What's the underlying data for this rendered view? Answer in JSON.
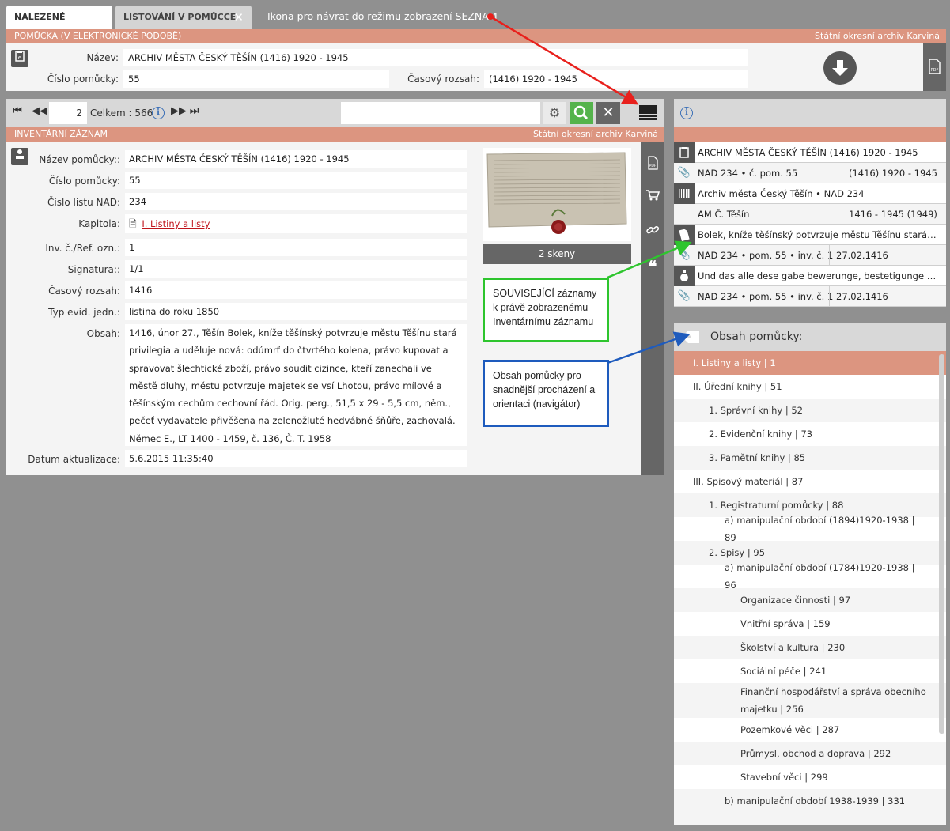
{
  "tabs": [
    {
      "label": "NALEZENÉ ZÁZNAMY"
    },
    {
      "label": "LISTOVÁNÍ V POMŮCCE"
    }
  ],
  "annotation_top": "Ikona pro návrat do režimu zobrazení SEZNAM",
  "helper": {
    "bar_title": "POMŮCKA (V ELEKTRONICKÉ PODOBĚ)",
    "bar_right": "Státní okresní archiv Karviná",
    "name_label": "Název:",
    "name_value": "ARCHIV MĚSTA ČESKÝ TĚŠÍN (1416) 1920 - 1945",
    "number_label": "Číslo pomůcky:",
    "number_value": "55",
    "range_label": "Časový rozsah:",
    "range_value": "(1416) 1920 - 1945"
  },
  "toolbar": {
    "page": "2",
    "total": "Celkem : 566",
    "info_glyph": "i"
  },
  "record": {
    "bar_title": "INVENTÁRNÍ ZÁZNAM",
    "bar_right": "Státní okresní archiv Karviná",
    "fields": {
      "nazev_label": "Název pomůcky::",
      "nazev_value": "ARCHIV MĚSTA ČESKÝ TĚŠÍN (1416) 1920 - 1945",
      "cislo_label": "Číslo pomůcky:",
      "cislo_value": "55",
      "nad_label": "Číslo listu NAD:",
      "nad_value": "234",
      "kapitola_label": "Kapitola:",
      "kapitola_value": "I. Listiny a listy",
      "inv_label": "Inv. č./Ref. ozn.:",
      "inv_value": "1",
      "signatura_label": "Signatura::",
      "signatura_value": "1/1",
      "rozsah_label": "Časový rozsah:",
      "rozsah_value": "1416",
      "typ_label": "Typ evid. jedn.:",
      "typ_value": "listina do roku 1850",
      "obsah_label": "Obsah:",
      "obsah_value": "1416, únor 27., Těšín Bolek, kníže těšínský potvrzuje městu Těšínu stará privilegia a uděluje nová: odúmrť do čtvrtého kolena, právo kupovat a spravovat šlechtické zboží, právo soudit cizince, kteří zanechali ve městě dluhy, městu potvrzuje majetek se vsí Lhotou, právo mílové a těšínským cechům cechovní řád. Orig. perg., 51,5 x 29 - 5,5 cm, něm., pečeť vydavatele přivěšena na zelenožluté hedvábné šňůře, zachovalá. Němec E., LT 1400 - 1459, č. 136, Č. T. 1958",
      "datum_label": "Datum aktualizace:",
      "datum_value": "5.6.2015 11:35:40"
    },
    "scan_label": "2 skeny"
  },
  "callouts": {
    "green": "SOUVISEJÍCÍ záznamy k právě zobrazenému Inventárnímu záznamu",
    "blue": "Obsah pomůcky pro snadnější procházení a orientaci (navigátor)"
  },
  "related": [
    {
      "icon": "book-icon",
      "text": "ARCHIV MĚSTA ČESKÝ TĚŠÍN (1416) 1920 - 1945",
      "text2": ""
    },
    {
      "icon": "paperclip-icon",
      "text": "NAD 234 • č. pom. 55",
      "text2": "(1416) 1920 - 1945"
    },
    {
      "icon": "barcode-icon",
      "text": "Archiv města Český Těšín • NAD 234",
      "text2": ""
    },
    {
      "icon": "",
      "text": "AM Č. Těšín",
      "text2": "1416 - 1945 (1949)"
    },
    {
      "icon": "document-icon",
      "text": "Bolek, kníže těšínský potvrzuje městu Těšínu stará priv...",
      "text2": ""
    },
    {
      "icon": "paperclip-icon",
      "text": "NAD 234 • pom. 55 • inv. č. 1",
      "text2": "27.02.1416"
    },
    {
      "icon": "seal-icon",
      "text": "Und das alle dese gabe bewerunge, bestetigunge von u...",
      "text2": ""
    },
    {
      "icon": "paperclip-icon",
      "text": "NAD 234 • pom. 55 • inv. č. 1",
      "text2": "27.02.1416"
    }
  ],
  "toc": {
    "title": "Obsah pomůcky:",
    "items": [
      {
        "label": "I. Listiny a listy | 1",
        "level": 0,
        "selected": true
      },
      {
        "label": "II. Úřední knihy | 51",
        "level": 0
      },
      {
        "label": "1. Správní knihy | 52",
        "level": 1
      },
      {
        "label": "2. Evidenční knihy | 73",
        "level": 1
      },
      {
        "label": "3. Pamětní knihy | 85",
        "level": 1
      },
      {
        "label": "III. Spisový materiál | 87",
        "level": 0
      },
      {
        "label": "1. Registraturní pomůcky | 88",
        "level": 1
      },
      {
        "label": "a) manipulační období (1894)1920-1938 | 89",
        "level": 2
      },
      {
        "label": "2. Spisy | 95",
        "level": 1
      },
      {
        "label": "a) manipulační období (1784)1920-1938 | 96",
        "level": 2
      },
      {
        "label": "Organizace činnosti | 97",
        "level": 3
      },
      {
        "label": "Vnitřní správa | 159",
        "level": 3
      },
      {
        "label": "Školství a kultura | 230",
        "level": 3
      },
      {
        "label": "Sociální péče | 241",
        "level": 3
      },
      {
        "label": "Finanční hospodářství a správa obecního majetku | 256",
        "level": 3,
        "tall": true
      },
      {
        "label": "Pozemkové věci | 287",
        "level": 3
      },
      {
        "label": "Průmysl, obchod a doprava | 292",
        "level": 3
      },
      {
        "label": "Stavební věci | 299",
        "level": 3
      },
      {
        "label": "b) manipulační období 1938-1939 | 331",
        "level": 2
      }
    ]
  },
  "colors": {
    "accent": "#dc9580",
    "background": "#909090",
    "green_callout": "#2ec52e",
    "blue_callout": "#1e5bbd",
    "red_arrow": "#e8201c"
  }
}
